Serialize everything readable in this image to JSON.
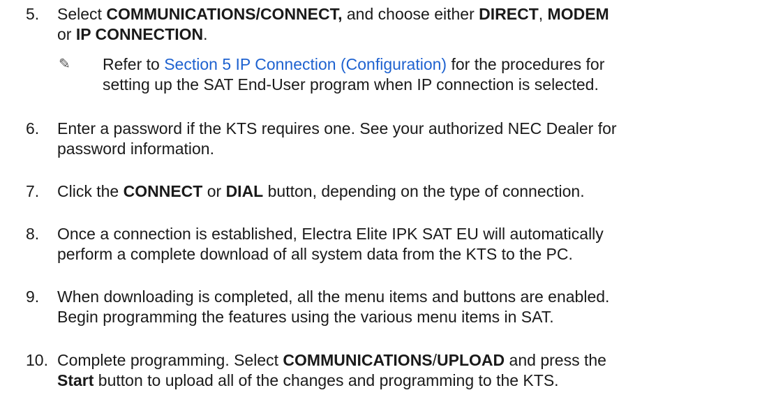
{
  "steps": [
    {
      "num": "5.",
      "line1": {
        "a": "Select ",
        "b": "COMMUNICATIONS/CONNECT,",
        "c": " and choose either ",
        "d": "DIRECT",
        "e": ", ",
        "f": "MODEM"
      },
      "line2": {
        "a": "or ",
        "b": "IP CONNECTION",
        "c": "."
      },
      "note": {
        "icon": "pencil-icon",
        "pre": "Refer to ",
        "link": "Section 5 IP Connection (Configuration)",
        "post1": " for the procedures for",
        "line2": "setting up the SAT End-User program when IP connection is selected."
      }
    },
    {
      "num": "6.",
      "line1": "Enter a password if the KTS requires one. See your authorized NEC Dealer for",
      "line2": "password information."
    },
    {
      "num": "7.",
      "line1": {
        "a": "Click the ",
        "b": "CONNECT",
        "c": " or ",
        "d": "DIAL",
        "e": " button, depending on the type of connection."
      }
    },
    {
      "num": "8.",
      "line1": "Once a connection is established, Electra Elite IPK SAT EU will automatically",
      "line2": "perform a complete download of all system data from the KTS to the PC."
    },
    {
      "num": "9.",
      "line1": "When downloading is completed, all the menu items and buttons are enabled.",
      "line2": "Begin programming the features using the various menu items in SAT."
    },
    {
      "num": "10.",
      "line1": {
        "a": "Complete programming. Select ",
        "b": "COMMUNICATIONS",
        "c": "/",
        "d": "UPLOAD",
        "e": " and press the"
      },
      "line2": {
        "a": "Start",
        "b": " button to upload all of the changes and programming to the KTS."
      }
    }
  ]
}
